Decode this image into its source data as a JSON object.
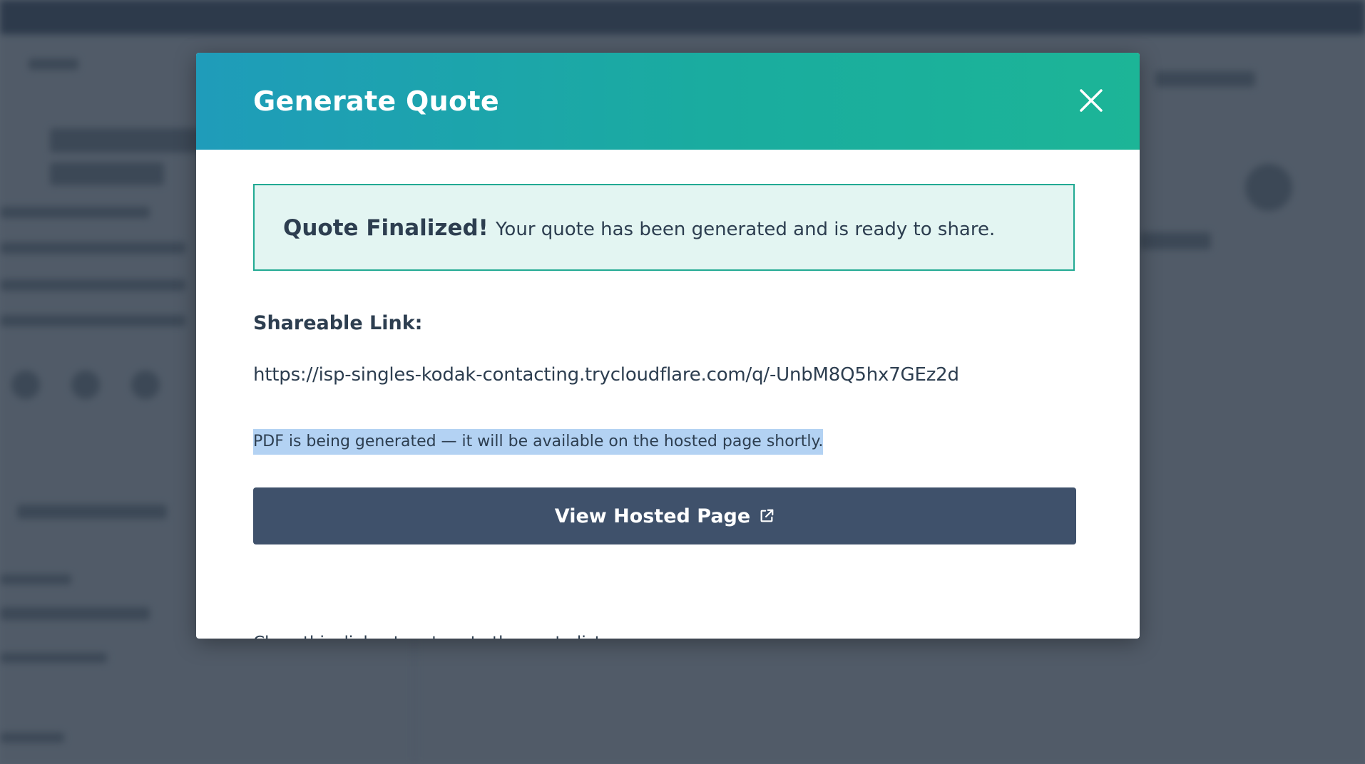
{
  "modal": {
    "title": "Generate Quote",
    "close_icon": "close-icon",
    "success": {
      "title": "Quote Finalized!",
      "message": "Your quote has been generated and is ready to share."
    },
    "link_label": "Shareable Link:",
    "link_url": "https://isp-singles-kodak-contacting.trycloudflare.com/q/-UnbM8Q5hx7GEz2d",
    "pdf_note": "PDF is being generated — it will be available on the hosted page shortly.",
    "view_button": {
      "label": "View Hosted Page",
      "icon": "external-link-icon"
    },
    "close_hint": "Close this dialog to return to the quote list."
  },
  "colors": {
    "header_gradient_start": "#1f9cba",
    "header_gradient_end": "#1cb597",
    "success_border": "#22aa93",
    "success_background": "#e3f5f2",
    "primary_button": "#3f516b",
    "text": "#2d3e50",
    "selection_highlight": "#b3d2f3"
  }
}
